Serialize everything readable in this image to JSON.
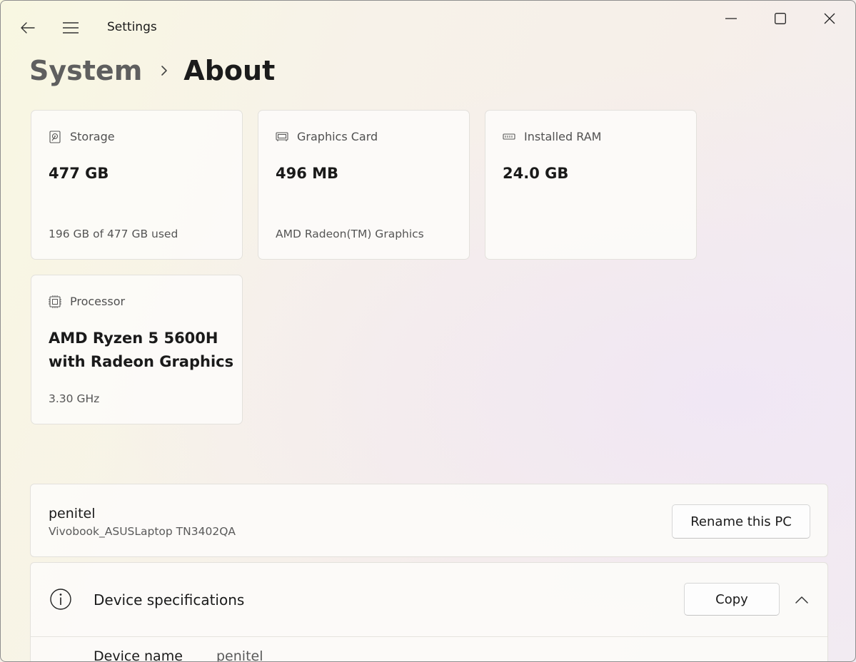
{
  "window": {
    "title": "Settings"
  },
  "icons": {
    "back": "back-arrow-icon",
    "menu": "hamburger-menu-icon",
    "minimize": "minimize-icon",
    "maximize": "maximize-icon",
    "close": "close-icon"
  },
  "breadcrumb": {
    "parent": "System",
    "current": "About"
  },
  "tiles": [
    {
      "label": "Storage",
      "value": "477 GB",
      "sub": "196 GB of 477 GB used",
      "icon": "storage-drive-icon"
    },
    {
      "label": "Graphics Card",
      "value": "496 MB",
      "sub": "AMD Radeon(TM) Graphics",
      "icon": "graphics-card-icon"
    },
    {
      "label": "Installed RAM",
      "value": "24.0 GB",
      "sub": "",
      "icon": "ram-icon"
    },
    {
      "label": "Processor",
      "value": "AMD Ryzen 5 5600H with Radeon Graphics",
      "sub": "3.30 GHz",
      "icon": "processor-chip-icon"
    }
  ],
  "pc": {
    "name": "penitel",
    "model": "Vivobook_ASUSLaptop TN3402QA",
    "rename_label": "Rename this PC"
  },
  "device_specs": {
    "title": "Device specifications",
    "copy_label": "Copy",
    "rows": [
      {
        "label": "Device name",
        "value": "penitel"
      }
    ]
  }
}
